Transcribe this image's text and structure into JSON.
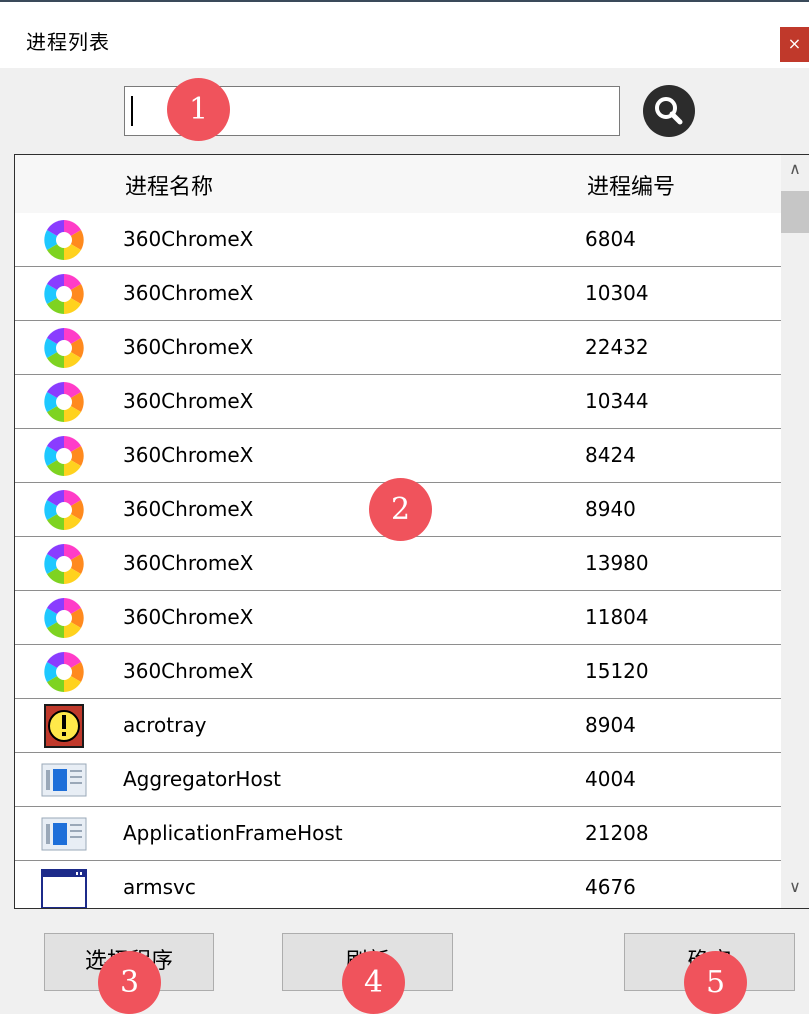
{
  "window": {
    "title": "进程列表",
    "close_label": "×"
  },
  "search": {
    "value": "",
    "button_icon": "search-icon"
  },
  "table": {
    "columns": [
      "进程名称",
      "进程编号"
    ],
    "rows": [
      {
        "icon": "360chrome-icon",
        "name": "360ChromeX",
        "pid": "6804"
      },
      {
        "icon": "360chrome-icon",
        "name": "360ChromeX",
        "pid": "10304"
      },
      {
        "icon": "360chrome-icon",
        "name": "360ChromeX",
        "pid": "22432"
      },
      {
        "icon": "360chrome-icon",
        "name": "360ChromeX",
        "pid": "10344"
      },
      {
        "icon": "360chrome-icon",
        "name": "360ChromeX",
        "pid": "8424"
      },
      {
        "icon": "360chrome-icon",
        "name": "360ChromeX",
        "pid": "8940"
      },
      {
        "icon": "360chrome-icon",
        "name": "360ChromeX",
        "pid": "13980"
      },
      {
        "icon": "360chrome-icon",
        "name": "360ChromeX",
        "pid": "11804"
      },
      {
        "icon": "360chrome-icon",
        "name": "360ChromeX",
        "pid": "15120"
      },
      {
        "icon": "acrotray-icon",
        "name": "acrotray",
        "pid": "8904"
      },
      {
        "icon": "app-window-icon",
        "name": "AggregatorHost",
        "pid": "4004"
      },
      {
        "icon": "app-window-icon",
        "name": "ApplicationFrameHost",
        "pid": "21208"
      },
      {
        "icon": "window-icon",
        "name": "armsvc",
        "pid": "4676"
      }
    ]
  },
  "buttons": {
    "select": "选择程序",
    "refresh": "刷新",
    "confirm": "确定"
  },
  "markers": [
    "1",
    "2",
    "3",
    "4",
    "5"
  ],
  "colors": {
    "marker": "#f0535c",
    "close": "#c0392b",
    "accent": "#1e6fd9"
  }
}
